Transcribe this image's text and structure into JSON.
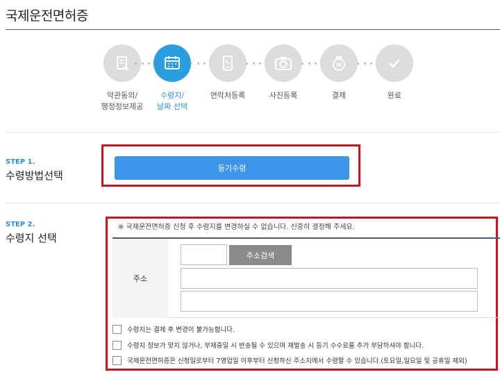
{
  "page": {
    "title": "국제운전면허증"
  },
  "stepper": {
    "steps": [
      {
        "label_line1": "약관동의/",
        "label_line2": "행정정보제공",
        "icon": "document-icon",
        "active": false
      },
      {
        "label_line1": "수령지/",
        "label_line2": "날짜 선택",
        "icon": "calendar-icon",
        "active": true
      },
      {
        "label_line1": "연락처등록",
        "label_line2": "",
        "icon": "phone-icon",
        "active": false
      },
      {
        "label_line1": "사진등록",
        "label_line2": "",
        "icon": "camera-icon",
        "active": false
      },
      {
        "label_line1": "결제",
        "label_line2": "",
        "icon": "payment-icon",
        "active": false
      },
      {
        "label_line1": "완료",
        "label_line2": "",
        "icon": "check-icon",
        "active": false
      }
    ]
  },
  "step1": {
    "tag": "STEP 1.",
    "heading": "수령방법선택",
    "button_label": "등기수령"
  },
  "step2": {
    "tag": "STEP 2.",
    "heading": "수령지 선택",
    "notice": "※ 국제운전면허증 신청 후 수령지를 변경하실 수 없습니다. 신중히 결정해 주세요.",
    "address_label": "주소",
    "search_label": "주소검색",
    "checks": [
      "수령지는 결제 후 변경이 불가능합니다.",
      "수령지 정보가 맞지 않거나, 부재중일 시 반송될 수 있으며 재발송 시 등기 수수료를 추가 부담하셔야 합니다.",
      "국제운전면허증은 신청일로부터 7영업일 이후부터 신청하신 주소지에서 수령할 수 있습니다.(토요일,일요일 및 공휴일 제외)"
    ]
  },
  "colors": {
    "accent": "#2a9fe0",
    "button": "#3d95ea",
    "highlight": "#d0121b",
    "inactive_step": "#dcdcdc"
  }
}
